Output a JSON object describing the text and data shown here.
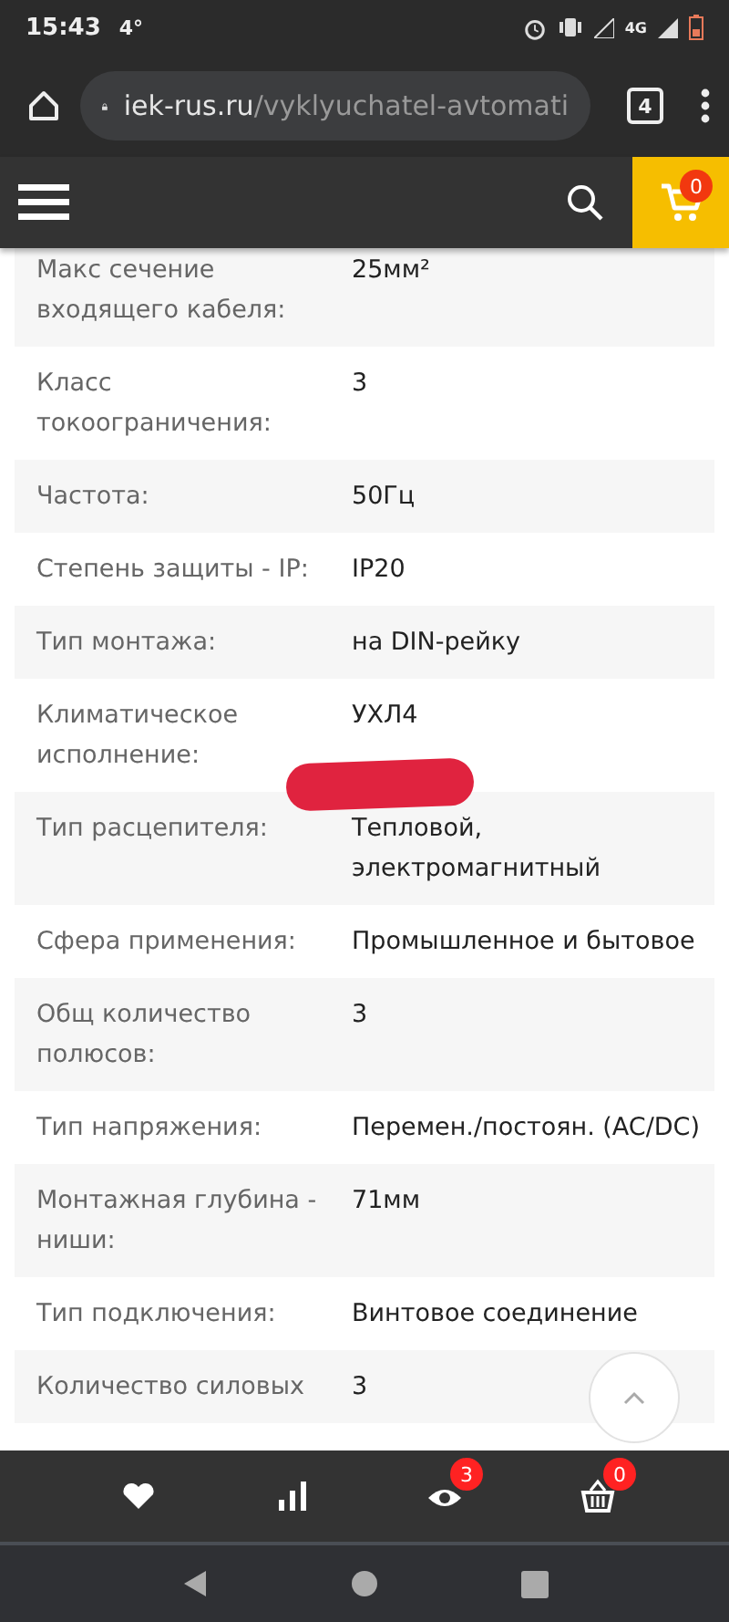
{
  "status_bar": {
    "time": "15:43",
    "temperature": "4°",
    "network": "4G"
  },
  "browser": {
    "domain": "iek-rus.ru",
    "path": "/vyklyuchatel-avtomati",
    "tab_count": "4"
  },
  "site_header": {
    "cart_count": "0"
  },
  "specs": [
    {
      "label": "Макс сечение входящего кабеля:",
      "value": "25мм²"
    },
    {
      "label": "Класс токоограничения:",
      "value": "3"
    },
    {
      "label": "Частота:",
      "value": "50Гц"
    },
    {
      "label": "Степень защиты - IP:",
      "value": "IP20"
    },
    {
      "label": "Тип монтажа:",
      "value": "на DIN-рейку"
    },
    {
      "label": "Климатическое исполнение:",
      "value": "УХЛ4"
    },
    {
      "label": "Тип расцепителя:",
      "value": "Тепловой, электромагнитный"
    },
    {
      "label": "Сфера применения:",
      "value": "Промышленное и бытовое"
    },
    {
      "label": "Общ количество полюсов:",
      "value": "3"
    },
    {
      "label": "Тип напряжения:",
      "value": "Перемен./постоян. (AC/DC)"
    },
    {
      "label": "Монтажная глубина - ниши:",
      "value": "71мм"
    },
    {
      "label": "Тип подключения:",
      "value": "Винтовое соединение"
    },
    {
      "label": "Количество силовых",
      "value": "3"
    }
  ],
  "bottom_nav": [
    {
      "kind": "favorites"
    },
    {
      "kind": "compare"
    },
    {
      "kind": "viewed",
      "badge": "3"
    },
    {
      "kind": "basket",
      "badge": "0"
    }
  ]
}
